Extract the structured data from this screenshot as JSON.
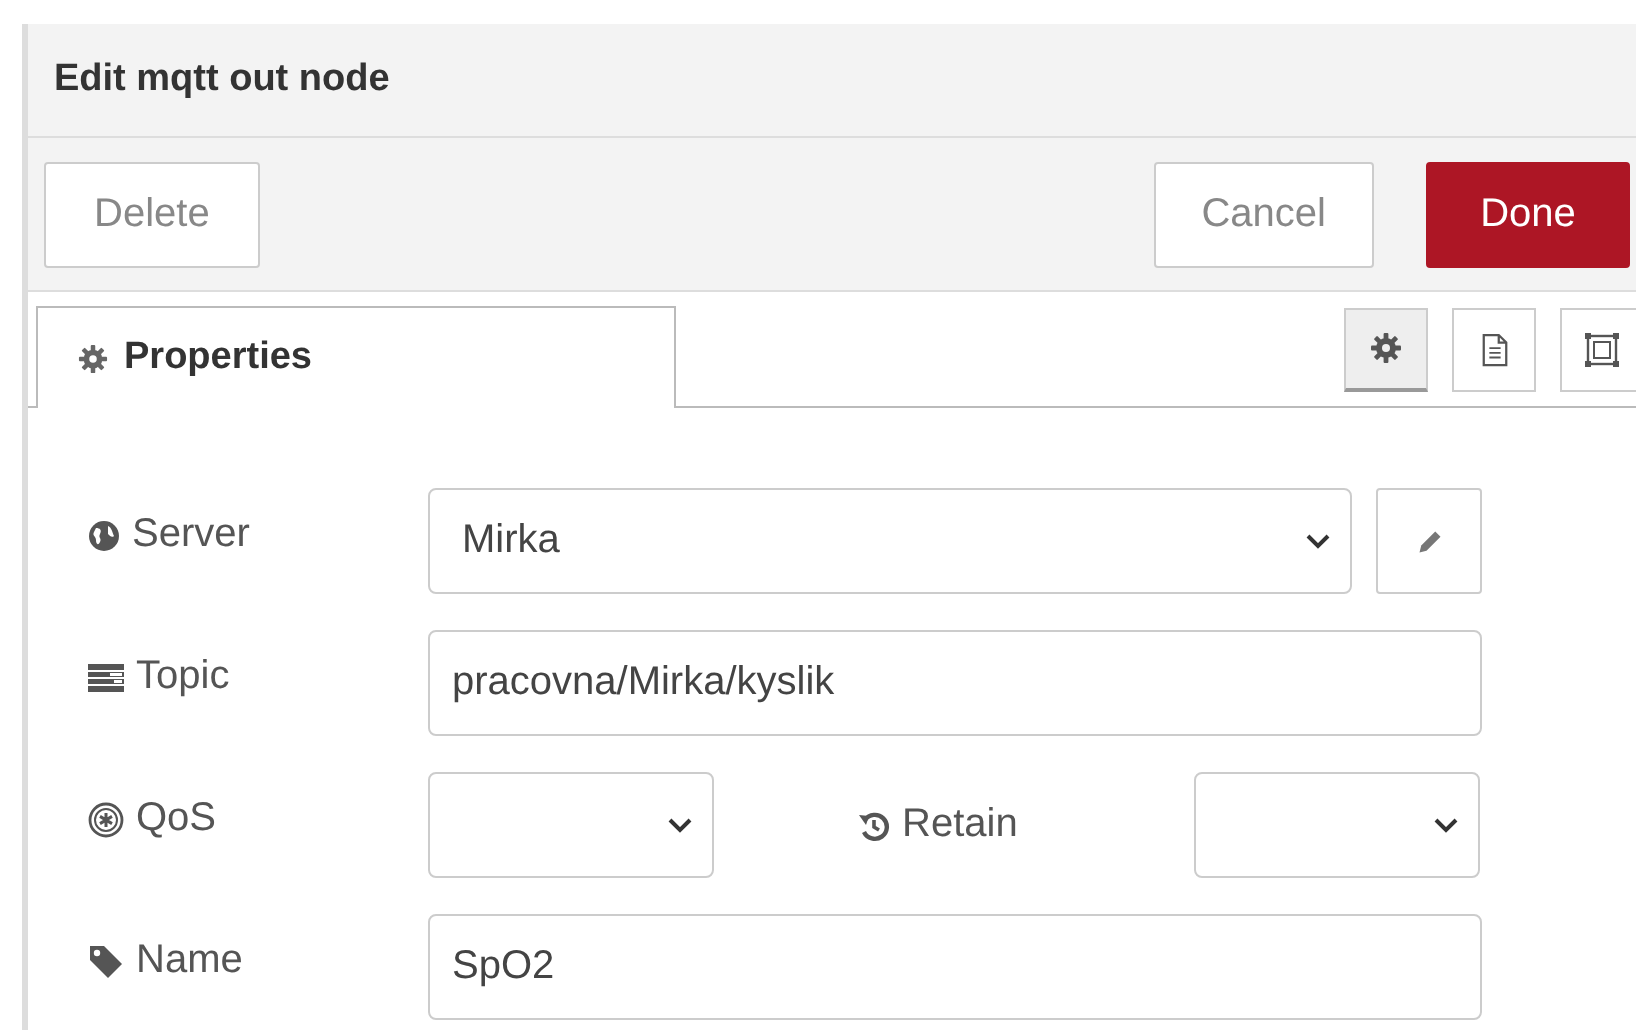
{
  "title": "Edit mqtt out node",
  "buttons": [
    {
      "label": "Delete",
      "kind": "plain"
    },
    {
      "label": "Cancel",
      "kind": "plain"
    },
    {
      "label": "Done",
      "kind": "primary"
    }
  ],
  "tabs": [
    {
      "label": "Properties",
      "selected": true
    }
  ],
  "tab_tools": [
    {
      "kind": "gear",
      "selected": true
    },
    {
      "kind": "document",
      "selected": false
    },
    {
      "kind": "frame",
      "selected": false
    }
  ],
  "rows": [
    {
      "kind": "select_edit",
      "label": "Server",
      "value": "Mirka"
    },
    {
      "kind": "text",
      "label": "Topic",
      "value": "pracovna/Mirka/kyslik"
    },
    {
      "kind": "select_pair",
      "label": "QoS",
      "second_label": "Retain"
    },
    {
      "kind": "text",
      "label": "Name",
      "value": "SpO2"
    }
  ]
}
